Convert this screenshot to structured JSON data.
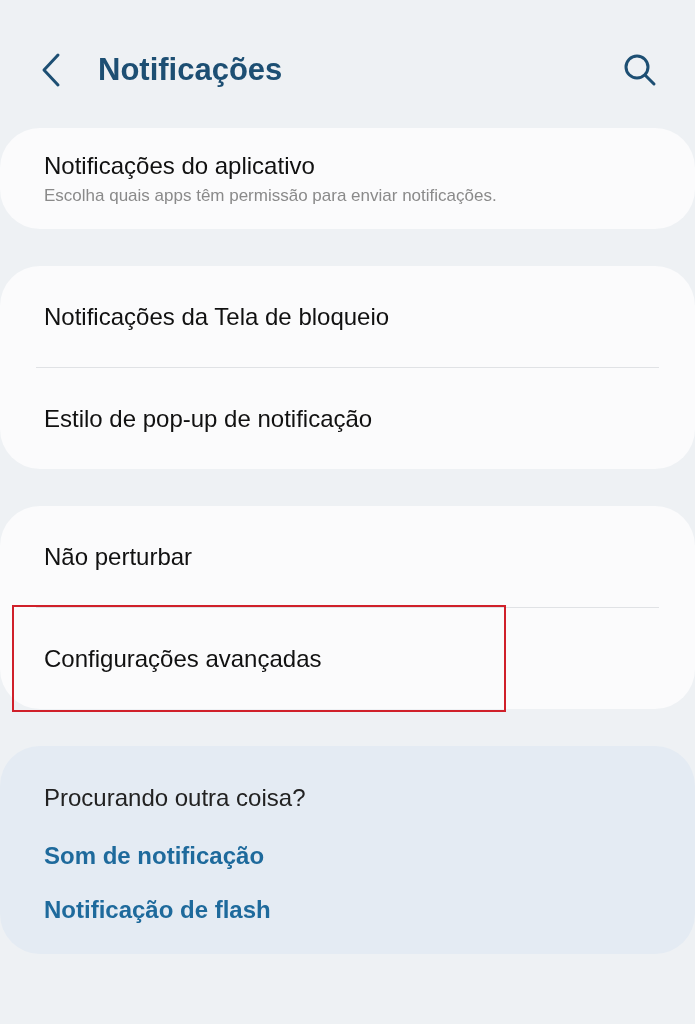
{
  "header": {
    "title": "Notificações"
  },
  "groups": [
    {
      "kind": "card",
      "items": [
        {
          "label": "Notificações do aplicativo",
          "description": "Escolha quais apps têm permissão para enviar notificações.",
          "highlighted": false
        }
      ]
    },
    {
      "kind": "card",
      "items": [
        {
          "label": "Notificações da Tela de bloqueio",
          "highlighted": false
        },
        {
          "label": "Estilo de pop-up de notificação",
          "highlighted": false
        }
      ]
    },
    {
      "kind": "card",
      "items": [
        {
          "label": "Não perturbar",
          "highlighted": false
        },
        {
          "label": "Configurações avançadas",
          "highlighted": true
        }
      ]
    }
  ],
  "suggestions": {
    "title": "Procurando outra coisa?",
    "links": [
      "Som de notificação",
      "Notificação de flash"
    ]
  }
}
